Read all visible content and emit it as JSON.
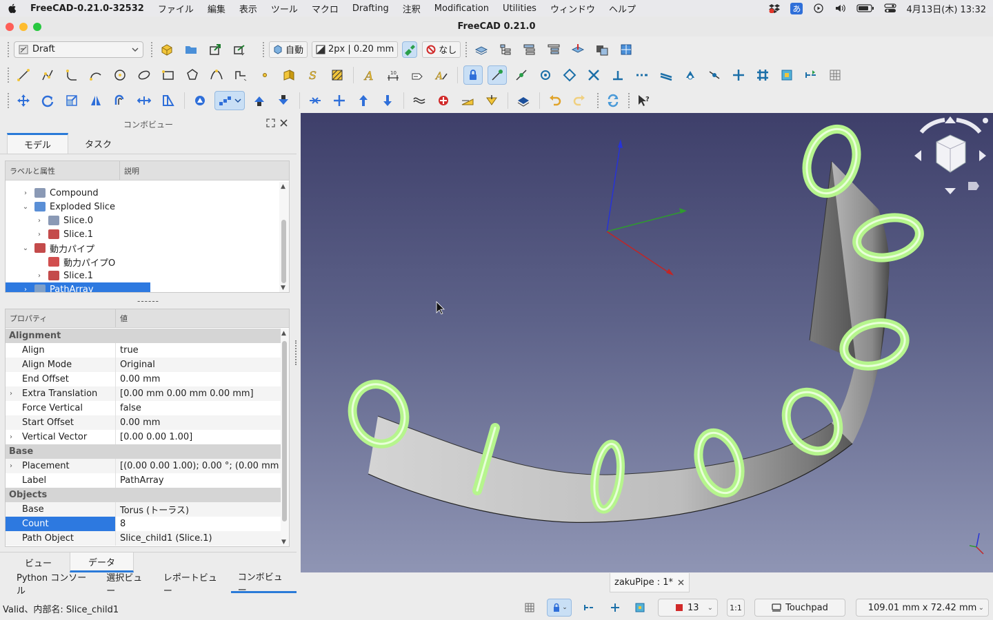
{
  "menubar": {
    "app": "FreeCAD-0.21.0-32532",
    "items": [
      "ファイル",
      "編集",
      "表示",
      "ツール",
      "マクロ",
      "Drafting",
      "注釈",
      "Modification",
      "Utilities",
      "ウィンドウ",
      "ヘルプ"
    ],
    "ime": "あ",
    "clock": "4月13日(木) 13:32"
  },
  "window": {
    "title": "FreeCAD 0.21.0"
  },
  "toolbar": {
    "workbench": "Draft",
    "auto_label": "自動",
    "line_width": "2px | 0.20 mm",
    "none_label": "なし"
  },
  "combo": {
    "title": "コンボビュー",
    "tabs": [
      "モデル",
      "タスク"
    ],
    "tree_header": {
      "label": "ラベルと属性",
      "desc": "説明"
    },
    "tree": [
      {
        "label": "Compound",
        "depth": 1,
        "expander": "›",
        "color": "#8a99b5"
      },
      {
        "label": "Exploded Slice",
        "depth": 1,
        "expander": "⌄",
        "color": "#5a8fd6"
      },
      {
        "label": "Slice.0",
        "depth": 2,
        "expander": "›",
        "color": "#8a99b5"
      },
      {
        "label": "Slice.1",
        "depth": 2,
        "expander": "›",
        "color": "#c44b4b"
      },
      {
        "label": "動力パイプ",
        "depth": 1,
        "expander": "⌄",
        "color": "#c44b4b"
      },
      {
        "label": "動力パイプO",
        "depth": 2,
        "expander": "",
        "color": "#d14f4f"
      },
      {
        "label": "Slice.1",
        "depth": 2,
        "expander": "›",
        "color": "#c44b4b"
      },
      {
        "label": "PathArray",
        "depth": 1,
        "expander": "›",
        "color": "#7fa0c8",
        "selected": true
      }
    ],
    "splitter": "------",
    "prop_header": {
      "name": "プロパティ",
      "value": "値"
    },
    "groups": [
      {
        "name": "Alignment",
        "rows": [
          {
            "name": "Align",
            "value": "true"
          },
          {
            "name": "Align Mode",
            "value": "Original"
          },
          {
            "name": "End Offset",
            "value": "0.00 mm"
          },
          {
            "name": "Extra Translation",
            "value": "[0.00 mm  0.00 mm  0.00 mm]",
            "expandable": true
          },
          {
            "name": "Force Vertical",
            "value": "false"
          },
          {
            "name": "Start Offset",
            "value": "0.00 mm"
          },
          {
            "name": "Vertical Vector",
            "value": "[0.00 0.00 1.00]",
            "expandable": true
          }
        ]
      },
      {
        "name": "Base",
        "rows": [
          {
            "name": "Placement",
            "value": "[(0.00 0.00 1.00); 0.00 °; (0.00 mm  0...",
            "expandable": true
          },
          {
            "name": "Label",
            "value": "PathArray"
          }
        ]
      },
      {
        "name": "Objects",
        "rows": [
          {
            "name": "Base",
            "value": "Torus (トーラス)"
          },
          {
            "name": "Count",
            "value": "8",
            "selected": true
          },
          {
            "name": "Path Object",
            "value": "Slice_child1 (Slice.1)"
          }
        ]
      }
    ],
    "bottom_tabs": [
      "ビュー",
      "データ"
    ]
  },
  "dock_tabs": [
    "Python コンソール",
    "選択ビュー",
    "レポートビュー",
    "コンボビュー"
  ],
  "document_tab": "zakuPipe : 1*",
  "status": {
    "message": "Valid、内部名: Slice_child1",
    "snap_size": "13",
    "scale": "1:1",
    "nav_style": "Touchpad",
    "dimensions": "109.01 mm x 72.42 mm"
  }
}
